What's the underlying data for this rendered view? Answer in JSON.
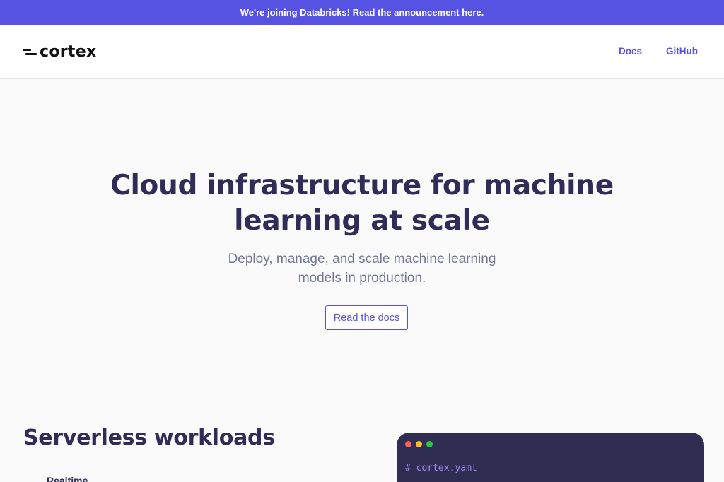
{
  "banner": {
    "text": "We're joining Databricks! Read the announcement here."
  },
  "nav": {
    "logo_text": "cortex",
    "links": [
      {
        "label": "Docs"
      },
      {
        "label": "GitHub"
      }
    ]
  },
  "hero": {
    "title_line1": "Cloud infrastructure for machine",
    "title_line2": "learning at scale",
    "subtitle_line1": "Deploy, manage, and scale machine learning",
    "subtitle_line2": "models in production.",
    "cta_label": "Read the docs"
  },
  "features": {
    "title": "Serverless workloads",
    "items": [
      {
        "label": "Realtime"
      }
    ]
  },
  "code_window": {
    "lines": [
      "# cortex.yaml"
    ]
  },
  "colors": {
    "accent": "#5653e3",
    "heading": "#2f2d57",
    "subtext": "#6e7691",
    "code_bg": "#302d53"
  }
}
